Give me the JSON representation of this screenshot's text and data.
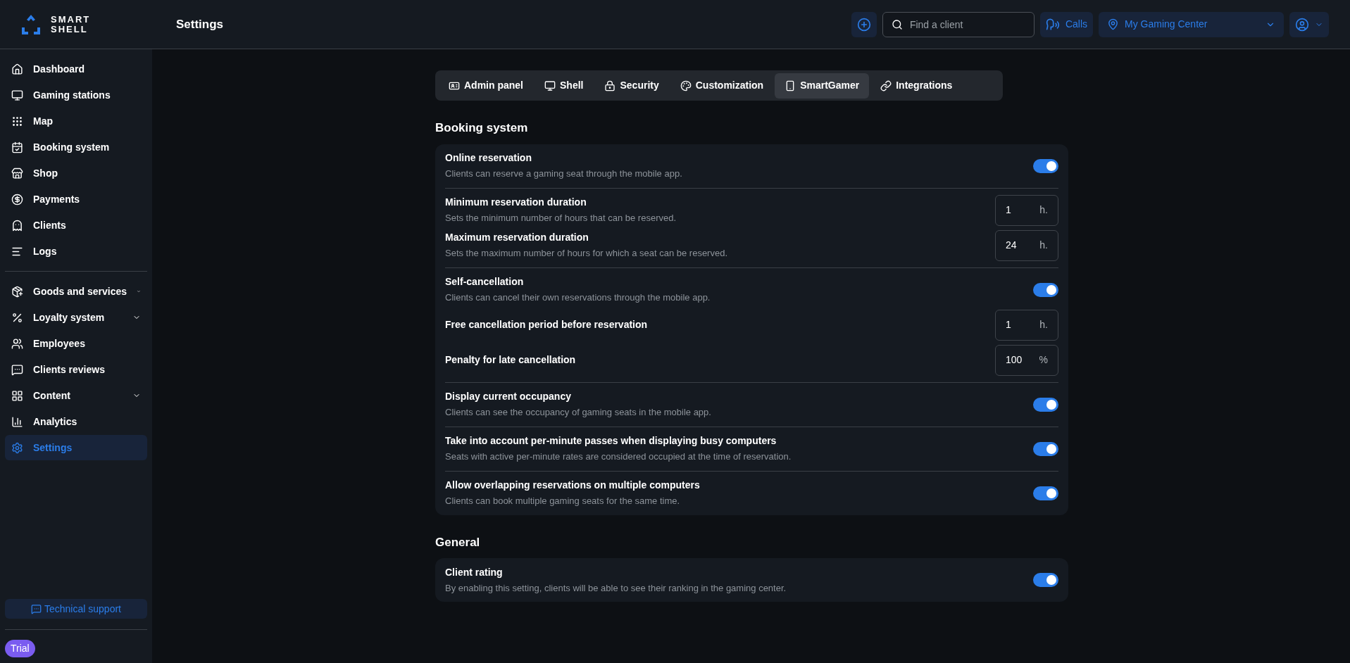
{
  "logo": {
    "line1": "SMART",
    "line2": "SHELL"
  },
  "header": {
    "title": "Settings",
    "search": {
      "placeholder": "Find a client"
    },
    "calls": "Calls",
    "center": "My Gaming Center"
  },
  "sidebar": {
    "groups": [
      [
        {
          "label": "Dashboard",
          "selected": false,
          "expandable": false
        },
        {
          "label": "Gaming stations",
          "selected": false,
          "expandable": false
        },
        {
          "label": "Map",
          "selected": false,
          "expandable": false
        },
        {
          "label": "Booking system",
          "selected": false,
          "expandable": false
        },
        {
          "label": "Shop",
          "selected": false,
          "expandable": false
        },
        {
          "label": "Payments",
          "selected": false,
          "expandable": false
        },
        {
          "label": "Clients",
          "selected": false,
          "expandable": false
        },
        {
          "label": "Logs",
          "selected": false,
          "expandable": false
        }
      ],
      [
        {
          "label": "Goods and services",
          "selected": false,
          "expandable": true
        },
        {
          "label": "Loyalty system",
          "selected": false,
          "expandable": true
        },
        {
          "label": "Employees",
          "selected": false,
          "expandable": false
        },
        {
          "label": "Clients reviews",
          "selected": false,
          "expandable": false
        },
        {
          "label": "Content",
          "selected": false,
          "expandable": true
        },
        {
          "label": "Analytics",
          "selected": false,
          "expandable": false
        },
        {
          "label": "Settings",
          "selected": true,
          "expandable": false
        }
      ]
    ],
    "support": "Technical support",
    "badge": "Trial"
  },
  "tabs": [
    {
      "label": "Admin panel",
      "selected": false
    },
    {
      "label": "Shell",
      "selected": false
    },
    {
      "label": "Security",
      "selected": false
    },
    {
      "label": "Customization",
      "selected": false
    },
    {
      "label": "SmartGamer",
      "selected": true
    },
    {
      "label": "Integrations",
      "selected": false
    }
  ],
  "sections": [
    {
      "title": "Booking system",
      "groups": [
        [
          {
            "kind": "toggle",
            "title": "Online reservation",
            "description": "Clients can reserve a gaming seat through the mobile app.",
            "on": true
          }
        ],
        [
          {
            "kind": "number",
            "title": "Minimum reservation duration",
            "description": "Sets the minimum number of hours that can be reserved.",
            "value": "1",
            "unit": "h."
          },
          {
            "kind": "number",
            "title": "Maximum reservation duration",
            "description": "Sets the maximum number of hours for which a seat can be reserved.",
            "value": "24",
            "unit": "h."
          }
        ],
        [
          {
            "kind": "toggle",
            "title": "Self-cancellation",
            "description": "Clients can cancel their own reservations through the mobile app.",
            "on": true
          },
          {
            "kind": "number",
            "title": "Free cancellation period before reservation",
            "value": "1",
            "unit": "h."
          },
          {
            "kind": "number",
            "title": "Penalty for late cancellation",
            "value": "100",
            "unit": "%"
          }
        ],
        [
          {
            "kind": "toggle",
            "title": "Display current occupancy",
            "description": "Clients can see the occupancy of gaming seats in the mobile app.",
            "on": true
          }
        ],
        [
          {
            "kind": "toggle",
            "title": "Take into account per-minute passes when displaying busy computers",
            "description": "Seats with active per-minute rates are considered occupied at the time of reservation.",
            "on": true
          }
        ],
        [
          {
            "kind": "toggle",
            "title": "Allow overlapping reservations on multiple computers",
            "description": "Clients can book multiple gaming seats for the same time.",
            "on": true
          }
        ]
      ]
    },
    {
      "title": "General",
      "groups": [
        [
          {
            "kind": "toggle",
            "title": "Client rating",
            "description": "By enabling this setting, clients will be able to see their ranking in the gaming center.",
            "on": true
          }
        ]
      ]
    }
  ]
}
